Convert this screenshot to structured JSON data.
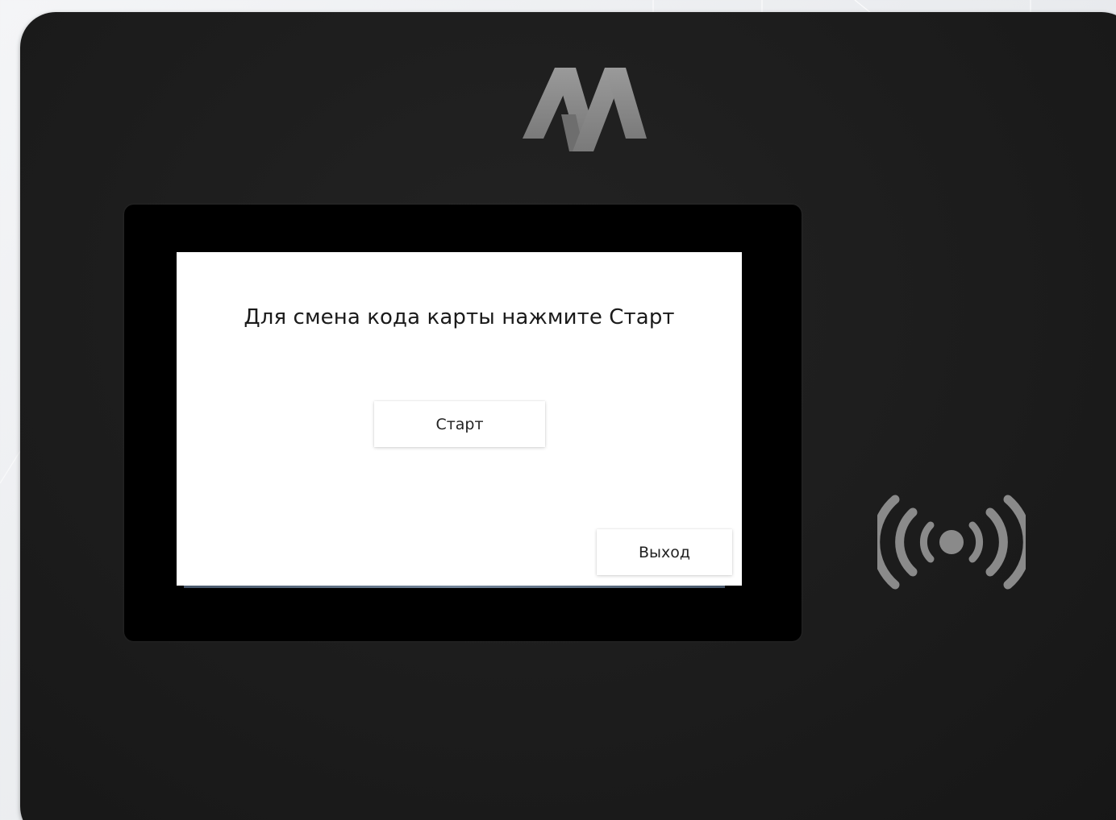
{
  "screen": {
    "prompt_text": "Для смена кода карты нажмите Старт",
    "start_button_label": "Старт",
    "exit_button_label": "Выход"
  },
  "device": {
    "logo_icon": "brand-logo-icon",
    "nfc_icon": "contactless-reader-icon"
  },
  "colors": {
    "device_body": "#1c1c1c",
    "bezel": "#000000",
    "screen_background": "#ffffff",
    "logo": "#8c8c8c",
    "nfc_symbol": "#8a8a8a"
  }
}
